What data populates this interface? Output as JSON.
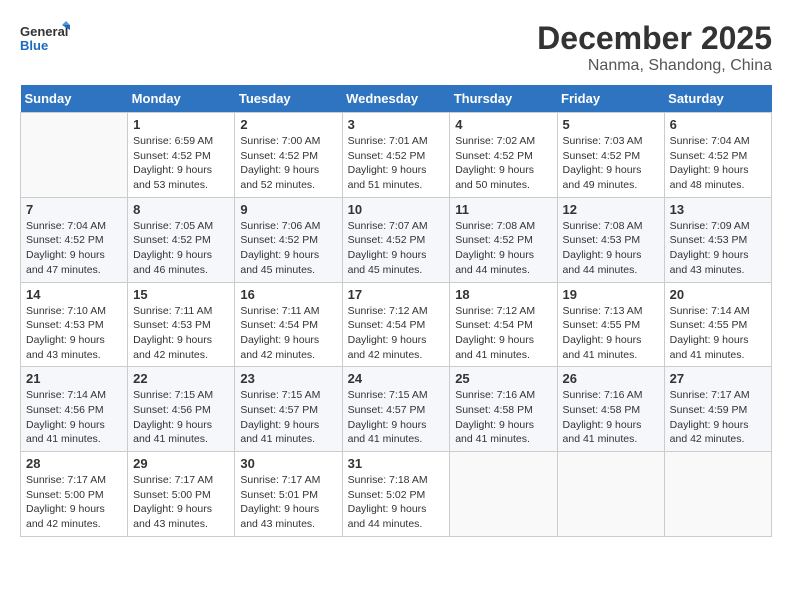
{
  "logo": {
    "line1": "General",
    "line2": "Blue"
  },
  "title": "December 2025",
  "location": "Nanma, Shandong, China",
  "weekdays": [
    "Sunday",
    "Monday",
    "Tuesday",
    "Wednesday",
    "Thursday",
    "Friday",
    "Saturday"
  ],
  "weeks": [
    [
      {
        "day": "",
        "sunrise": "",
        "sunset": "",
        "daylight": ""
      },
      {
        "day": "1",
        "sunrise": "Sunrise: 6:59 AM",
        "sunset": "Sunset: 4:52 PM",
        "daylight": "Daylight: 9 hours and 53 minutes."
      },
      {
        "day": "2",
        "sunrise": "Sunrise: 7:00 AM",
        "sunset": "Sunset: 4:52 PM",
        "daylight": "Daylight: 9 hours and 52 minutes."
      },
      {
        "day": "3",
        "sunrise": "Sunrise: 7:01 AM",
        "sunset": "Sunset: 4:52 PM",
        "daylight": "Daylight: 9 hours and 51 minutes."
      },
      {
        "day": "4",
        "sunrise": "Sunrise: 7:02 AM",
        "sunset": "Sunset: 4:52 PM",
        "daylight": "Daylight: 9 hours and 50 minutes."
      },
      {
        "day": "5",
        "sunrise": "Sunrise: 7:03 AM",
        "sunset": "Sunset: 4:52 PM",
        "daylight": "Daylight: 9 hours and 49 minutes."
      },
      {
        "day": "6",
        "sunrise": "Sunrise: 7:04 AM",
        "sunset": "Sunset: 4:52 PM",
        "daylight": "Daylight: 9 hours and 48 minutes."
      }
    ],
    [
      {
        "day": "7",
        "sunrise": "Sunrise: 7:04 AM",
        "sunset": "Sunset: 4:52 PM",
        "daylight": "Daylight: 9 hours and 47 minutes."
      },
      {
        "day": "8",
        "sunrise": "Sunrise: 7:05 AM",
        "sunset": "Sunset: 4:52 PM",
        "daylight": "Daylight: 9 hours and 46 minutes."
      },
      {
        "day": "9",
        "sunrise": "Sunrise: 7:06 AM",
        "sunset": "Sunset: 4:52 PM",
        "daylight": "Daylight: 9 hours and 45 minutes."
      },
      {
        "day": "10",
        "sunrise": "Sunrise: 7:07 AM",
        "sunset": "Sunset: 4:52 PM",
        "daylight": "Daylight: 9 hours and 45 minutes."
      },
      {
        "day": "11",
        "sunrise": "Sunrise: 7:08 AM",
        "sunset": "Sunset: 4:52 PM",
        "daylight": "Daylight: 9 hours and 44 minutes."
      },
      {
        "day": "12",
        "sunrise": "Sunrise: 7:08 AM",
        "sunset": "Sunset: 4:53 PM",
        "daylight": "Daylight: 9 hours and 44 minutes."
      },
      {
        "day": "13",
        "sunrise": "Sunrise: 7:09 AM",
        "sunset": "Sunset: 4:53 PM",
        "daylight": "Daylight: 9 hours and 43 minutes."
      }
    ],
    [
      {
        "day": "14",
        "sunrise": "Sunrise: 7:10 AM",
        "sunset": "Sunset: 4:53 PM",
        "daylight": "Daylight: 9 hours and 43 minutes."
      },
      {
        "day": "15",
        "sunrise": "Sunrise: 7:11 AM",
        "sunset": "Sunset: 4:53 PM",
        "daylight": "Daylight: 9 hours and 42 minutes."
      },
      {
        "day": "16",
        "sunrise": "Sunrise: 7:11 AM",
        "sunset": "Sunset: 4:54 PM",
        "daylight": "Daylight: 9 hours and 42 minutes."
      },
      {
        "day": "17",
        "sunrise": "Sunrise: 7:12 AM",
        "sunset": "Sunset: 4:54 PM",
        "daylight": "Daylight: 9 hours and 42 minutes."
      },
      {
        "day": "18",
        "sunrise": "Sunrise: 7:12 AM",
        "sunset": "Sunset: 4:54 PM",
        "daylight": "Daylight: 9 hours and 41 minutes."
      },
      {
        "day": "19",
        "sunrise": "Sunrise: 7:13 AM",
        "sunset": "Sunset: 4:55 PM",
        "daylight": "Daylight: 9 hours and 41 minutes."
      },
      {
        "day": "20",
        "sunrise": "Sunrise: 7:14 AM",
        "sunset": "Sunset: 4:55 PM",
        "daylight": "Daylight: 9 hours and 41 minutes."
      }
    ],
    [
      {
        "day": "21",
        "sunrise": "Sunrise: 7:14 AM",
        "sunset": "Sunset: 4:56 PM",
        "daylight": "Daylight: 9 hours and 41 minutes."
      },
      {
        "day": "22",
        "sunrise": "Sunrise: 7:15 AM",
        "sunset": "Sunset: 4:56 PM",
        "daylight": "Daylight: 9 hours and 41 minutes."
      },
      {
        "day": "23",
        "sunrise": "Sunrise: 7:15 AM",
        "sunset": "Sunset: 4:57 PM",
        "daylight": "Daylight: 9 hours and 41 minutes."
      },
      {
        "day": "24",
        "sunrise": "Sunrise: 7:15 AM",
        "sunset": "Sunset: 4:57 PM",
        "daylight": "Daylight: 9 hours and 41 minutes."
      },
      {
        "day": "25",
        "sunrise": "Sunrise: 7:16 AM",
        "sunset": "Sunset: 4:58 PM",
        "daylight": "Daylight: 9 hours and 41 minutes."
      },
      {
        "day": "26",
        "sunrise": "Sunrise: 7:16 AM",
        "sunset": "Sunset: 4:58 PM",
        "daylight": "Daylight: 9 hours and 41 minutes."
      },
      {
        "day": "27",
        "sunrise": "Sunrise: 7:17 AM",
        "sunset": "Sunset: 4:59 PM",
        "daylight": "Daylight: 9 hours and 42 minutes."
      }
    ],
    [
      {
        "day": "28",
        "sunrise": "Sunrise: 7:17 AM",
        "sunset": "Sunset: 5:00 PM",
        "daylight": "Daylight: 9 hours and 42 minutes."
      },
      {
        "day": "29",
        "sunrise": "Sunrise: 7:17 AM",
        "sunset": "Sunset: 5:00 PM",
        "daylight": "Daylight: 9 hours and 43 minutes."
      },
      {
        "day": "30",
        "sunrise": "Sunrise: 7:17 AM",
        "sunset": "Sunset: 5:01 PM",
        "daylight": "Daylight: 9 hours and 43 minutes."
      },
      {
        "day": "31",
        "sunrise": "Sunrise: 7:18 AM",
        "sunset": "Sunset: 5:02 PM",
        "daylight": "Daylight: 9 hours and 44 minutes."
      },
      {
        "day": "",
        "sunrise": "",
        "sunset": "",
        "daylight": ""
      },
      {
        "day": "",
        "sunrise": "",
        "sunset": "",
        "daylight": ""
      },
      {
        "day": "",
        "sunrise": "",
        "sunset": "",
        "daylight": ""
      }
    ]
  ]
}
